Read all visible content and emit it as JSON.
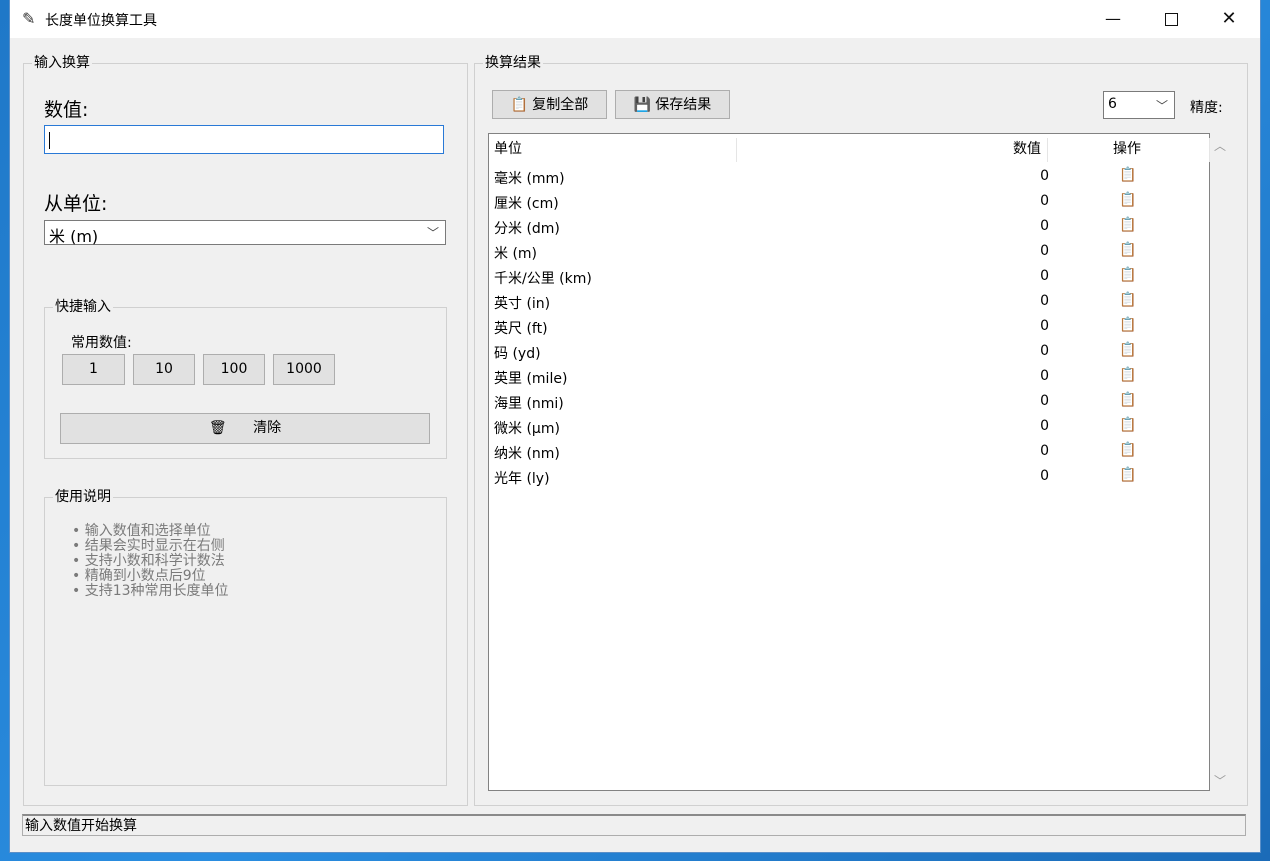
{
  "window": {
    "title": "长度单位换算工具",
    "controls": {
      "minimize": "—",
      "close": "✕"
    }
  },
  "input_panel": {
    "group_title": "输入换算",
    "value_label": "数值:",
    "value_input": "",
    "from_unit_label": "从单位:",
    "from_unit_selected": "米 (m)",
    "quick": {
      "group_title": "快捷输入",
      "common_label": "常用数值:",
      "buttons": [
        "1",
        "10",
        "100",
        "1000"
      ],
      "clear_label": "清除"
    },
    "help": {
      "group_title": "使用说明",
      "lines": [
        "• 输入数值和选择单位",
        "• 结果会实时显示在右侧",
        "• 支持小数和科学计数法",
        "• 精确到小数点后9位",
        "• 支持13种常用长度单位"
      ]
    }
  },
  "results_panel": {
    "group_title": "换算结果",
    "copy_all_label": "复制全部",
    "save_label": "保存结果",
    "precision_value": "6",
    "precision_label": "精度:",
    "columns": {
      "unit": "单位",
      "value": "数值",
      "action": "操作"
    },
    "rows": [
      {
        "unit": "毫米 (mm)",
        "value": "0"
      },
      {
        "unit": "厘米 (cm)",
        "value": "0"
      },
      {
        "unit": "分米 (dm)",
        "value": "0"
      },
      {
        "unit": "米 (m)",
        "value": "0"
      },
      {
        "unit": "千米/公里 (km)",
        "value": "0"
      },
      {
        "unit": "英寸 (in)",
        "value": "0"
      },
      {
        "unit": "英尺 (ft)",
        "value": "0"
      },
      {
        "unit": "码 (yd)",
        "value": "0"
      },
      {
        "unit": "英里 (mile)",
        "value": "0"
      },
      {
        "unit": "海里 (nmi)",
        "value": "0"
      },
      {
        "unit": "微米 (μm)",
        "value": "0"
      },
      {
        "unit": "纳米 (nm)",
        "value": "0"
      },
      {
        "unit": "光年 (ly)",
        "value": "0"
      }
    ]
  },
  "status_bar": "输入数值开始换算"
}
